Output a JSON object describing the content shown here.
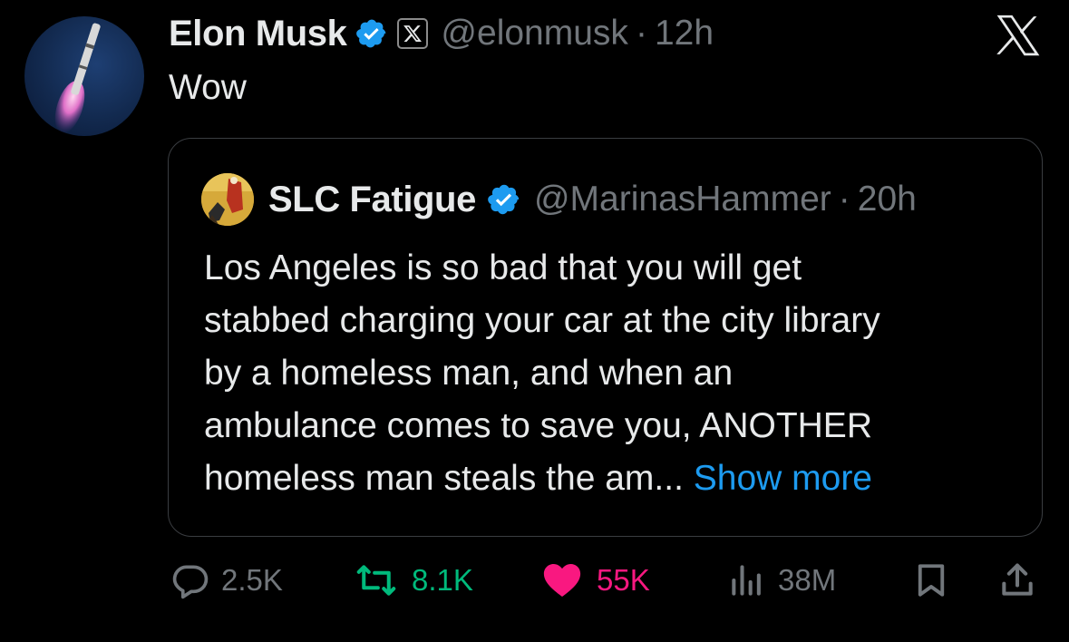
{
  "post": {
    "author_name": "Elon Musk",
    "handle": "@elonmusk",
    "separator": "·",
    "time": "12h",
    "text": "Wow"
  },
  "quote": {
    "author_name": "SLC Fatigue",
    "handle": "@MarinasHammer",
    "separator": "·",
    "time": "20h",
    "lines": [
      "Los Angeles is so bad that you will get",
      "stabbed charging your car at the city library",
      "by a homeless man, and when an",
      "ambulance comes to save you, ANOTHER"
    ],
    "last_line": "homeless man steals the am...",
    "show_more": "Show more"
  },
  "actions": {
    "replies": "2.5K",
    "reposts": "8.1K",
    "likes": "55K",
    "views": "38M"
  },
  "icons": {
    "verified": "verified-badge-icon",
    "affiliate": "x-affiliate-badge-icon",
    "logo": "x-logo-icon",
    "reply": "reply-icon",
    "repost": "repost-icon",
    "like": "heart-icon",
    "views": "views-icon",
    "bookmark": "bookmark-icon",
    "share": "share-icon"
  },
  "colors": {
    "background": "#000000",
    "text": "#e7e9ea",
    "secondary": "#71767b",
    "link": "#1d9bf0",
    "repost": "#00ba7c",
    "like": "#f91880",
    "verified": "#1d9bf0"
  }
}
